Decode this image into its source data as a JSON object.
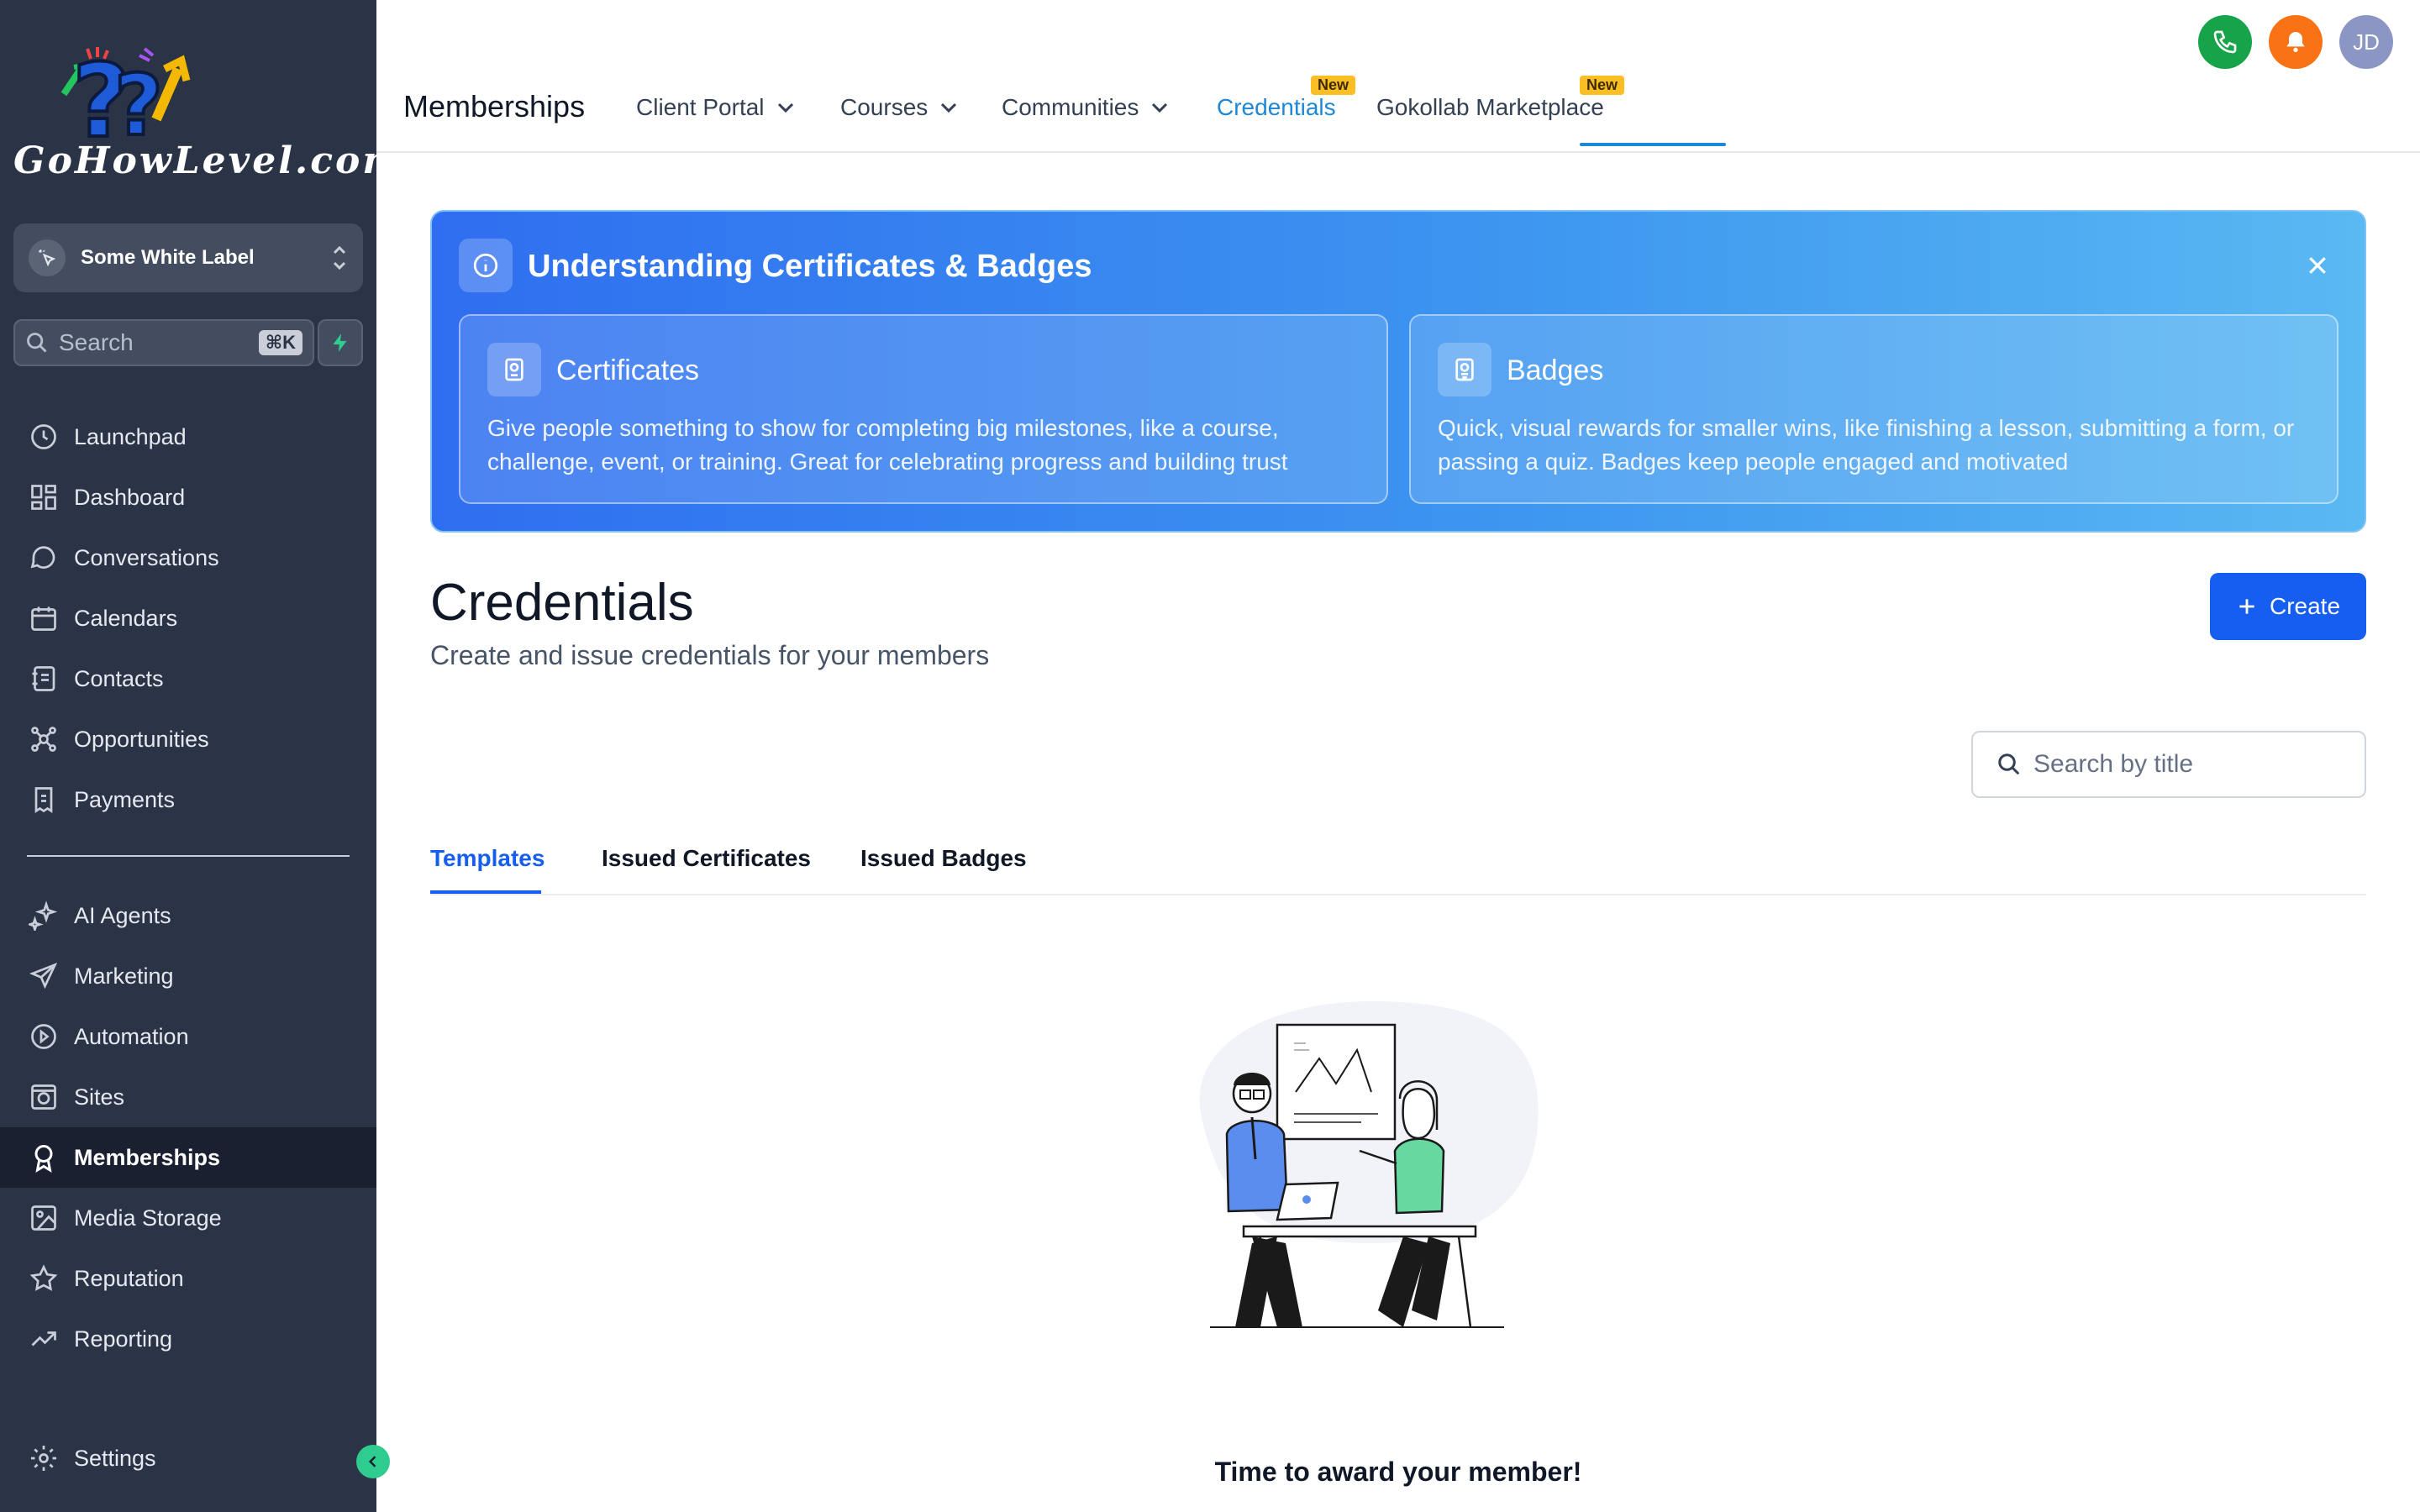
{
  "sidebar": {
    "logo_text": "GoHowLevel.com",
    "account": "Some White Label",
    "search": {
      "placeholder": "Search",
      "shortcut": "⌘K"
    },
    "nav_primary": [
      {
        "label": "Launchpad",
        "icon": "launchpad-icon"
      },
      {
        "label": "Dashboard",
        "icon": "dashboard-icon"
      },
      {
        "label": "Conversations",
        "icon": "chat-bubble-icon"
      },
      {
        "label": "Calendars",
        "icon": "calendar-icon"
      },
      {
        "label": "Contacts",
        "icon": "address-book-icon"
      },
      {
        "label": "Opportunities",
        "icon": "pipeline-icon"
      },
      {
        "label": "Payments",
        "icon": "invoice-icon"
      }
    ],
    "nav_secondary": [
      {
        "label": "AI Agents",
        "icon": "sparkle-icon"
      },
      {
        "label": "Marketing",
        "icon": "send-icon"
      },
      {
        "label": "Automation",
        "icon": "automation-icon"
      },
      {
        "label": "Sites",
        "icon": "globe-icon"
      },
      {
        "label": "Memberships",
        "icon": "award-icon",
        "active": true
      },
      {
        "label": "Media Storage",
        "icon": "image-icon"
      },
      {
        "label": "Reputation",
        "icon": "star-icon"
      },
      {
        "label": "Reporting",
        "icon": "trend-up-icon"
      }
    ],
    "settings": "Settings"
  },
  "topbar": {
    "title": "Memberships",
    "tabs": [
      {
        "label": "Client Portal",
        "has_dropdown": true
      },
      {
        "label": "Courses",
        "has_dropdown": true
      },
      {
        "label": "Communities",
        "has_dropdown": true
      },
      {
        "label": "Credentials",
        "active": true,
        "badge": "New"
      },
      {
        "label": "Gokollab Marketplace",
        "badge": "New"
      }
    ],
    "avatar_initials": "JD"
  },
  "banner": {
    "title": "Understanding Certificates & Badges",
    "cards": [
      {
        "title": "Certificates",
        "description": "Give people something to show for completing big milestones, like a course, challenge, event, or training. Great for celebrating progress and building trust"
      },
      {
        "title": "Badges",
        "description": "Quick, visual rewards for smaller wins, like finishing a lesson, submitting a form, or passing a quiz. Badges keep people engaged and motivated"
      }
    ]
  },
  "page": {
    "title": "Credentials",
    "subtitle": "Create and issue credentials for your members",
    "create_label": "Create",
    "search_placeholder": "Search by title",
    "tabs": [
      "Templates",
      "Issued Certificates",
      "Issued Badges"
    ],
    "active_tab": "Templates",
    "empty_title": "Time to award your member!"
  },
  "colors": {
    "sidebar_bg": "#2b3447",
    "accent": "#155eef",
    "tab_active": "#1e88d6",
    "phone_btn": "#16a34a",
    "bell_btn": "#f97316",
    "avatar": "#8c96c4"
  }
}
